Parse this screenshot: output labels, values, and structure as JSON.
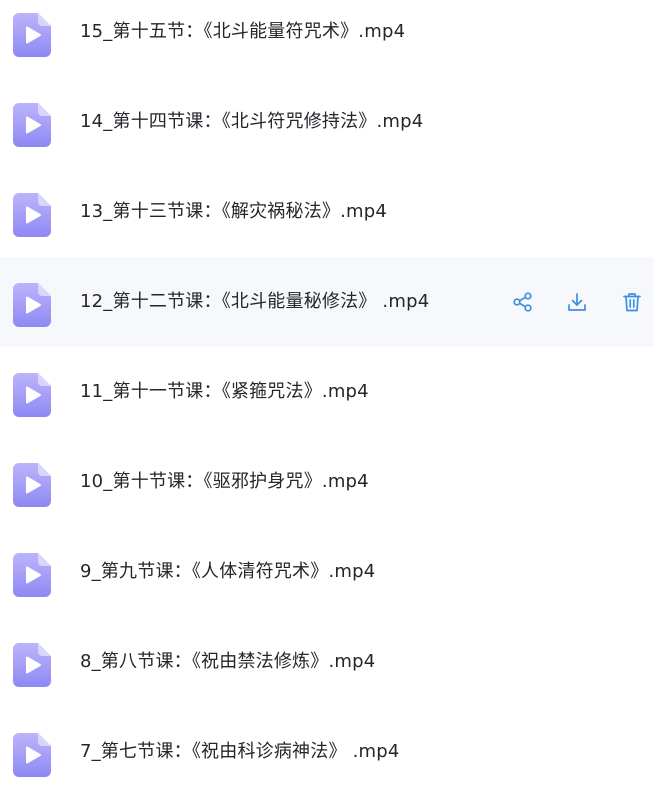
{
  "files": [
    {
      "name": "15_第十五节：《北斗能量符咒术》.mp4",
      "hovered": false
    },
    {
      "name": "14_第十四节课：《北斗符咒修持法》.mp4",
      "hovered": false
    },
    {
      "name": "13_第十三节课：《解灾祸秘法》.mp4",
      "hovered": false
    },
    {
      "name": "12_第十二节课：《北斗能量秘修法》 .mp4",
      "hovered": true
    },
    {
      "name": "11_第十一节课：《紧箍咒法》.mp4",
      "hovered": false
    },
    {
      "name": "10_第十节课：《驱邪护身咒》.mp4",
      "hovered": false
    },
    {
      "name": "9_第九节课：《人体清符咒术》.mp4",
      "hovered": false
    },
    {
      "name": "8_第八节课：《祝由禁法修炼》.mp4",
      "hovered": false
    },
    {
      "name": "7_第七节课：《祝由科诊病神法》 .mp4",
      "hovered": false
    }
  ],
  "icons": {
    "file": "video-file-icon",
    "share": "share-icon",
    "download": "download-icon",
    "delete": "trash-icon"
  },
  "colors": {
    "icon_gradient_top": "#b9b2fb",
    "icon_gradient_bottom": "#8c86f4",
    "action_blue": "#3d8fe0",
    "hover_bg": "#f6f8fc",
    "text": "#25262b"
  }
}
